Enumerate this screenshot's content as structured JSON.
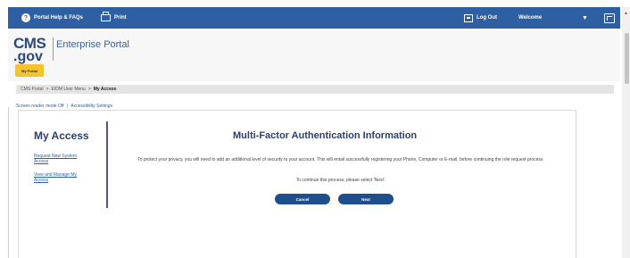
{
  "topbar": {
    "help_label": "Portal Help & FAQs",
    "print_label": "Print",
    "logout_label": "Log Out",
    "welcome_label": "Welcome",
    "chevron": "▼"
  },
  "header": {
    "logo_top": "CMS",
    "logo_bottom": ".gov",
    "portal_title": "Enterprise Portal",
    "my_portal_label": "My Portal"
  },
  "breadcrumb": {
    "items": [
      "CMS Portal",
      "EIDM User Menu",
      "My Access"
    ],
    "separator": ">"
  },
  "accessibility": {
    "screen_reader": "Screen reader mode Off",
    "separator": "|",
    "settings": "Accessibility Settings"
  },
  "sidebar": {
    "title": "My Access",
    "links": [
      "Request New System Access",
      "View and Manage My Access"
    ]
  },
  "main": {
    "title": "Multi-Factor Authentication Information",
    "description": "To protect your privacy, you will need to add an additional level of security to your account. This will entail successfully registering your Phone, Computer or E-mail, before continuing the role request process.",
    "instruction": "To continue this process, please select 'Next'.",
    "cancel_label": "Cancel",
    "next_label": "Next"
  },
  "colors": {
    "topbar": "#2f5fa3",
    "button": "#1f4e8c",
    "accent_yellow": "#f4c430",
    "title": "#2b3f6b"
  }
}
